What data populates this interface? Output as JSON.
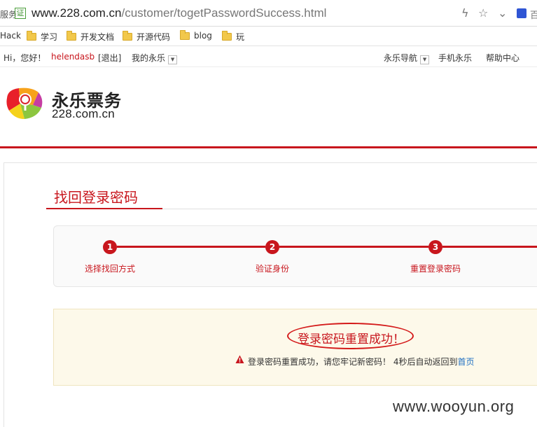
{
  "browser": {
    "left_fragment": "服务",
    "cert_label": "证",
    "url_host": "www.228.com.cn",
    "url_path": "/customer/togetPasswordSuccess.html",
    "right_fragment": "百",
    "bookmarks": [
      "Hack",
      "学习",
      "开发文档",
      "开源代码",
      "blog",
      "玩"
    ]
  },
  "topbar": {
    "greeting": "Hi，您好！",
    "username": "helendasb",
    "logout": "[退出]",
    "my_account": "我的永乐",
    "nav": "永乐导航",
    "mobile": "手机永乐",
    "help": "帮助中心"
  },
  "logo": {
    "name": "永乐票务",
    "domain": "228.com.cn"
  },
  "section_title": "找回登录密码",
  "steps": [
    {
      "num": "1",
      "label": "选择找回方式"
    },
    {
      "num": "2",
      "label": "验证身份"
    },
    {
      "num": "3",
      "label": "重置登录密码"
    }
  ],
  "result": {
    "title": "登录密码重置成功！",
    "message_prefix": "登录密码重置成功，请您牢记新密码！ 4秒后自动返回到",
    "home_link": "首页"
  },
  "watermark": "www.wooyun.org",
  "colors": {
    "brand_red": "#c8161d",
    "link_blue": "#1f6fc2",
    "notice_bg": "#fdf9ea"
  }
}
